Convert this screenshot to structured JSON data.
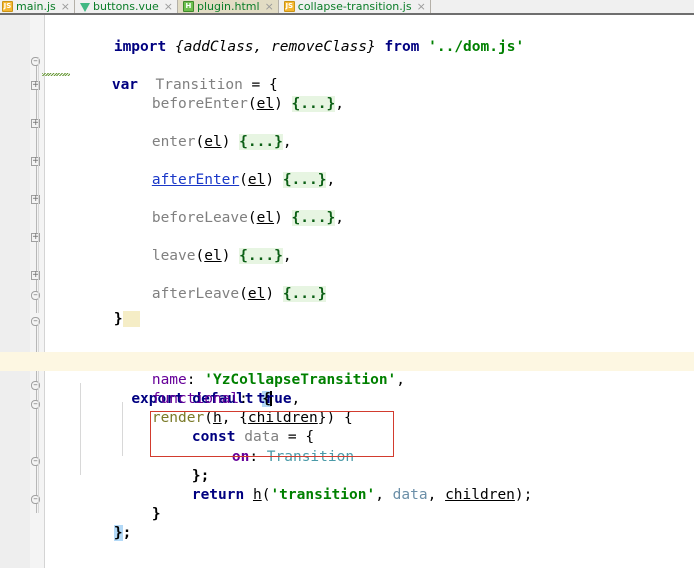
{
  "window": {
    "app": "code-editor",
    "colors": {
      "tab_active_bg": "#e2dcc4",
      "tab_inactive_bg": "#f0f0f0",
      "gutter_bg": "#eeeeee",
      "current_line_bg": "#fdf7e2",
      "fold_placeholder_bg": "#e7f5e2",
      "brace_match_bg": "#b3d9f7",
      "error_border": "#d23b2e",
      "keyword": "#000080",
      "string": "#008000",
      "property": "#660099",
      "identifier": "#808080",
      "function": "#7a7a28",
      "type": "#4a9aa8",
      "link": "#1a38c8"
    }
  },
  "tabs": [
    {
      "label": "main.js",
      "icon": "js-file-icon",
      "icon_text": "JS",
      "active": false,
      "close_label": "×"
    },
    {
      "label": "buttons.vue",
      "icon": "vue-file-icon",
      "icon_text": "",
      "active": false,
      "close_label": "×"
    },
    {
      "label": "plugin.html",
      "icon": "html-file-icon",
      "icon_text": "H",
      "active": true,
      "close_label": "×"
    },
    {
      "label": "collapse-transition.js",
      "icon": "js-file-icon",
      "icon_text": "JS",
      "active": false,
      "close_label": "×"
    }
  ],
  "editor": {
    "lines": {
      "import_kw": "import",
      "import_names": " {addClass, removeClass}",
      "import_from": " from ",
      "import_path": "'../dom.js'",
      "var_kw": "var",
      "var_name": "  Transition ",
      "var_assign": "= {",
      "m1_name": "beforeEnter",
      "m1_open": "(",
      "m1_arg": "el",
      "m1_close": ") ",
      "m1_fold": "{...}",
      "m1_comma": ",",
      "m2_name": "enter",
      "m3_name": "afterEnter",
      "m4_name": "beforeLeave",
      "m5_name": "leave",
      "m6_name": "afterLeave",
      "var_close": "}",
      "export_kw": "export default ",
      "export_brace": "{",
      "name_key": "name",
      "name_colon": ": ",
      "name_value": "'YzCollapseTransition'",
      "name_comma": ",",
      "functional_key": "functional",
      "functional_colon": ": ",
      "functional_value": "true",
      "functional_comma": ",",
      "render_name": "render",
      "render_open": "(",
      "render_h": "h",
      "render_sep": ", {",
      "render_children": "children",
      "render_close": "}) {",
      "const_kw": "const",
      "const_name": " data ",
      "const_assign": "= {",
      "on_key": "on",
      "on_colon": ": ",
      "on_value": "Transition",
      "obj_close": "};",
      "return_kw": "return",
      "return_fn": "h",
      "return_open": "(",
      "return_str": "'transition'",
      "return_comma1": ", ",
      "return_data": "data",
      "return_comma2": ", ",
      "return_children": "children",
      "return_close": ");",
      "render_close_brace": "}",
      "export_close": "}",
      "export_semi": ";"
    },
    "fold_markers": {
      "collapsed": "+",
      "expanded": "–"
    }
  }
}
